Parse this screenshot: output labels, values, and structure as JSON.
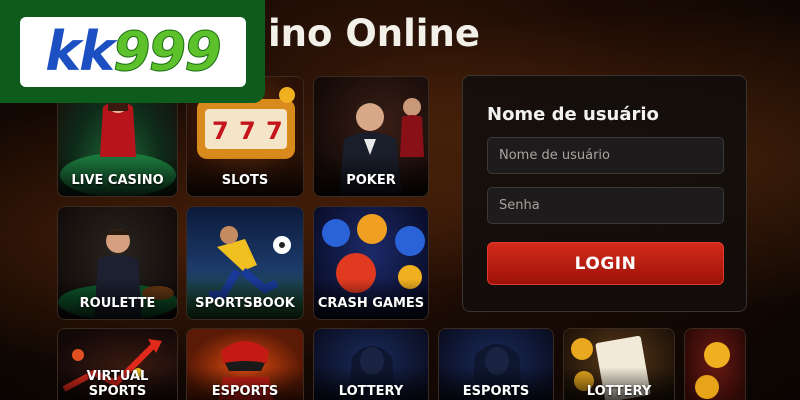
{
  "brand": {
    "logo_kk": "kk",
    "logo_999": "999"
  },
  "header": {
    "title": "ino Online"
  },
  "games": [
    {
      "label": "LIVE CASINO"
    },
    {
      "label": "SLOTS"
    },
    {
      "label": "POKER"
    },
    {
      "label": "ROULETTE"
    },
    {
      "label": "SPORTSBOOK"
    },
    {
      "label": "CRASH GAMES"
    },
    {
      "label": "VIRTUAL SPORTS"
    },
    {
      "label": "ESPORTS"
    },
    {
      "label": "LOTTERY"
    },
    {
      "label": "ESPORTS"
    },
    {
      "label": "LOTTERY"
    },
    {
      "label": ""
    }
  ],
  "login": {
    "title": "Nome de usuário",
    "username_placeholder": "Nome de usuário",
    "password_placeholder": "Senha",
    "button_label": "LOGIN"
  },
  "colors": {
    "logo_bg": "#0d5c1c",
    "logo_kk": "#1b4fc2",
    "logo_999": "#5cc12a",
    "login_button": "#c41e12"
  }
}
